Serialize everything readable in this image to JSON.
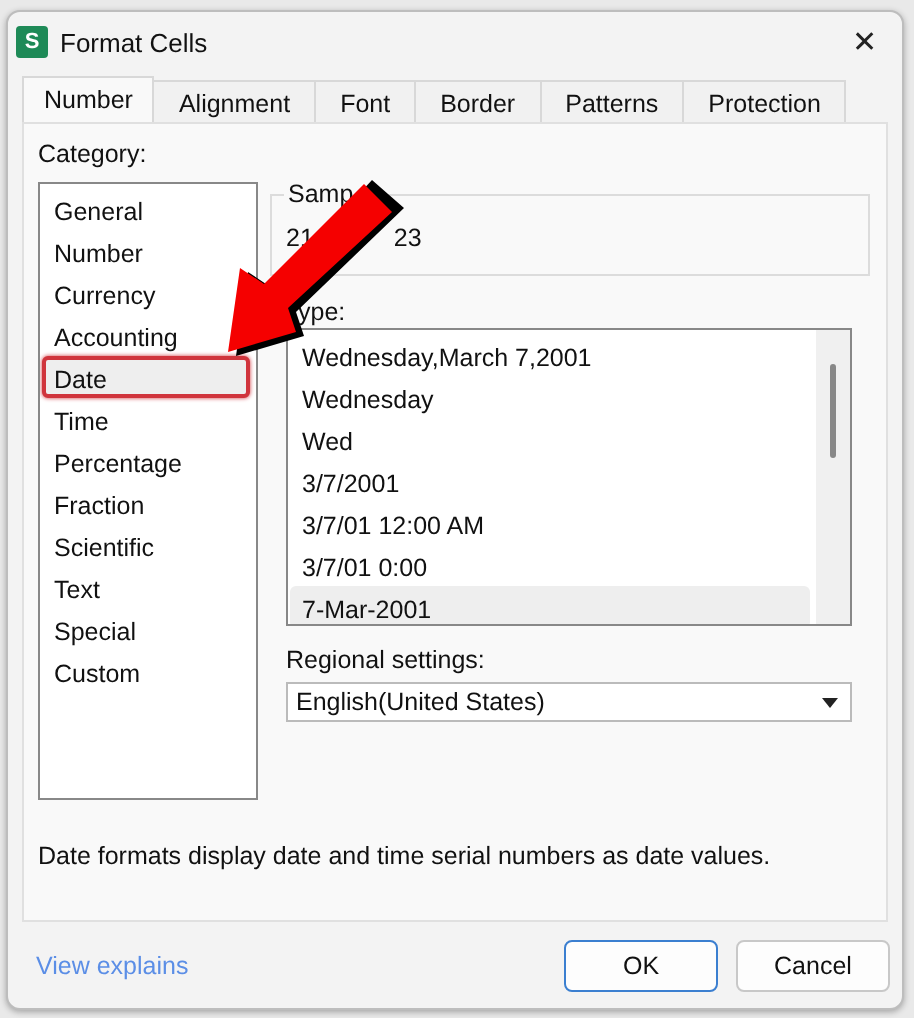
{
  "window": {
    "app_icon": "S",
    "title": "Format Cells",
    "close": "✕"
  },
  "tabs": [
    {
      "label": "Number",
      "selected": true
    },
    {
      "label": "Alignment",
      "selected": false
    },
    {
      "label": "Font",
      "selected": false
    },
    {
      "label": "Border",
      "selected": false
    },
    {
      "label": "Patterns",
      "selected": false
    },
    {
      "label": "Protection",
      "selected": false
    }
  ],
  "category": {
    "label": "Category:",
    "items": [
      {
        "label": "General",
        "selected": false,
        "highlighted": false
      },
      {
        "label": "Number",
        "selected": false,
        "highlighted": false
      },
      {
        "label": "Currency",
        "selected": false,
        "highlighted": false
      },
      {
        "label": "Accounting",
        "selected": false,
        "highlighted": false
      },
      {
        "label": "Date",
        "selected": true,
        "highlighted": true
      },
      {
        "label": "Time",
        "selected": false,
        "highlighted": false
      },
      {
        "label": "Percentage",
        "selected": false,
        "highlighted": false
      },
      {
        "label": "Fraction",
        "selected": false,
        "highlighted": false
      },
      {
        "label": "Scientific",
        "selected": false,
        "highlighted": false
      },
      {
        "label": "Text",
        "selected": false,
        "highlighted": false
      },
      {
        "label": "Special",
        "selected": false,
        "highlighted": false
      },
      {
        "label": "Custom",
        "selected": false,
        "highlighted": false
      }
    ]
  },
  "sample": {
    "label": "Samp",
    "value_parts": [
      "21",
      "23"
    ]
  },
  "type": {
    "label": "ype:",
    "items": [
      {
        "label": "Wednesday,March 7,2001",
        "selected": false
      },
      {
        "label": "Wednesday",
        "selected": false
      },
      {
        "label": "Wed",
        "selected": false
      },
      {
        "label": "3/7/2001",
        "selected": false
      },
      {
        "label": "3/7/01 12:00 AM",
        "selected": false
      },
      {
        "label": "3/7/01 0:00",
        "selected": false
      },
      {
        "label": "7-Mar-2001",
        "selected": true
      }
    ]
  },
  "regional": {
    "label": "Regional settings:",
    "value": "English(United States)"
  },
  "description": "Date formats display date and time serial numbers as date values.",
  "footer": {
    "link": "View explains",
    "buttons": [
      {
        "label": "OK",
        "kind": "default"
      },
      {
        "label": "Cancel",
        "kind": "normal"
      }
    ]
  },
  "annotation": {
    "kind": "arrow"
  }
}
